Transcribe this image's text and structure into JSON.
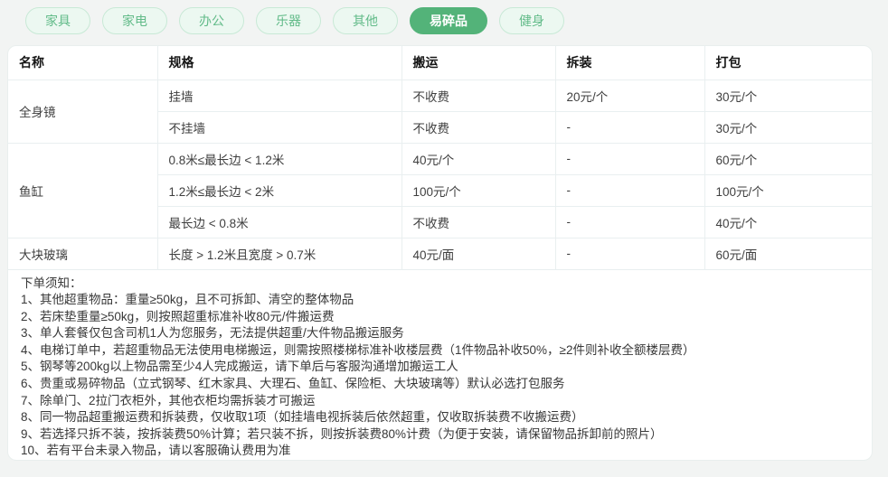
{
  "tabs": [
    {
      "label": "家具",
      "active": false
    },
    {
      "label": "家电",
      "active": false
    },
    {
      "label": "办公",
      "active": false
    },
    {
      "label": "乐器",
      "active": false
    },
    {
      "label": "其他",
      "active": false
    },
    {
      "label": "易碎品",
      "active": true
    },
    {
      "label": "健身",
      "active": false
    }
  ],
  "table": {
    "headers": [
      "名称",
      "规格",
      "搬运",
      "拆装",
      "打包"
    ],
    "groups": [
      {
        "name": "全身镜",
        "rows": [
          {
            "spec": "挂墙",
            "move": "不收费",
            "disassembly": "20元/个",
            "pack": "30元/个"
          },
          {
            "spec": "不挂墙",
            "move": "不收费",
            "disassembly": "-",
            "pack": "30元/个"
          }
        ]
      },
      {
        "name": "鱼缸",
        "rows": [
          {
            "spec": "0.8米≤最长边 < 1.2米",
            "move": "40元/个",
            "disassembly": "-",
            "pack": "60元/个"
          },
          {
            "spec": "1.2米≤最长边 < 2米",
            "move": "100元/个",
            "disassembly": "-",
            "pack": "100元/个"
          },
          {
            "spec": "最长边 < 0.8米",
            "move": "不收费",
            "disassembly": "-",
            "pack": "40元/个"
          }
        ]
      },
      {
        "name": "大块玻璃",
        "rows": [
          {
            "spec": "长度 > 1.2米且宽度 > 0.7米",
            "move": "40元/面",
            "disassembly": "-",
            "pack": "60元/面"
          }
        ]
      }
    ]
  },
  "notes": {
    "title": "下单须知：",
    "items": [
      "1、其他超重物品：重量≥50kg，且不可拆卸、清空的整体物品",
      "2、若床垫重量≥50kg，则按照超重标准补收80元/件搬运费",
      "3、单人套餐仅包含司机1人为您服务，无法提供超重/大件物品搬运服务",
      "4、电梯订单中，若超重物品无法使用电梯搬运，则需按照楼梯标准补收楼层费（1件物品补收50%，≥2件则补收全额楼层费）",
      "5、钢琴等200kg以上物品需至少4人完成搬运，请下单后与客服沟通增加搬运工人",
      "6、贵重或易碎物品（立式钢琴、红木家具、大理石、鱼缸、保险柜、大块玻璃等）默认必选打包服务",
      "7、除单门、2拉门衣柜外，其他衣柜均需拆装才可搬运",
      "8、同一物品超重搬运费和拆装费，仅收取1项（如挂墙电视拆装后依然超重，仅收取拆装费不收搬运费）",
      "9、若选择只拆不装，按拆装费50%计算；若只装不拆，则按拆装费80%计费（为便于安装，请保留物品拆卸前的照片）",
      "10、若有平台未录入物品，请以客服确认费用为准"
    ]
  },
  "colors": {
    "accent_green": "#53b379",
    "tab_inactive_bg": "#ecf8f1",
    "tab_inactive_border": "#c8e9d6",
    "tab_inactive_text": "#62bb89",
    "page_bg": "#f2f4f3",
    "card_border": "#e9efee",
    "table_line": "#e9eff0"
  }
}
